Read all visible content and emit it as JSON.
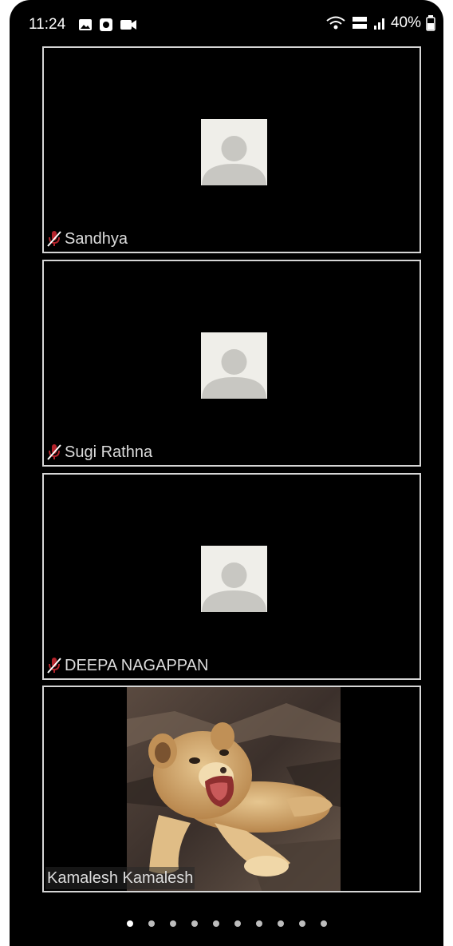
{
  "status_bar": {
    "time": "11:24",
    "left_icons": [
      "gallery-icon",
      "app-icon",
      "video-camera-icon"
    ],
    "right_icons": [
      "wifi-icon",
      "volte-lte-icon",
      "signal-icon"
    ],
    "battery": "40%"
  },
  "participants": [
    {
      "name": "Sandhya",
      "muted": true,
      "has_video": false
    },
    {
      "name": "Sugi Rathna",
      "muted": true,
      "has_video": false
    },
    {
      "name": "DEEPA NAGAPPAN",
      "muted": true,
      "has_video": false
    },
    {
      "name": "Kamalesh Kamalesh",
      "muted": false,
      "has_video": true,
      "video_content": "lion-cub"
    }
  ],
  "pagination": {
    "total": 10,
    "current": 1
  },
  "colors": {
    "background": "#000000",
    "tile_border": "#d6d6d6",
    "avatar_bg": "#efeee9",
    "avatar_fg": "#c8c7c2",
    "mic_muted": "#b3232b"
  }
}
